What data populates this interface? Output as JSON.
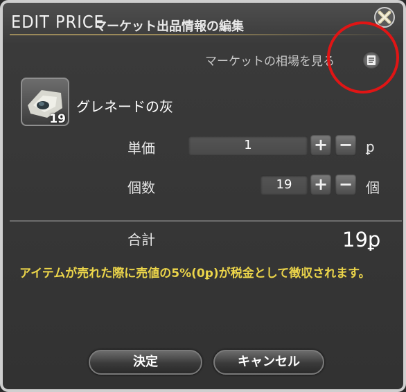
{
  "window": {
    "title_en": "EDIT PRICE",
    "title_jp": "マーケット出品情報の編集",
    "close_icon": "close-x-icon"
  },
  "market": {
    "link_label": "マーケットの相場を見る",
    "icon": "document-icon",
    "annotation_color": "#e01515"
  },
  "item": {
    "name": "グレネードの灰",
    "quantity": "19",
    "icon": "grenade-ash-icon"
  },
  "unit_price": {
    "label": "単価",
    "value": "1",
    "unit": "ꝑ",
    "plus": "+",
    "minus": "−"
  },
  "quantity": {
    "label": "個数",
    "value": "19",
    "unit": "個",
    "plus": "+",
    "minus": "−"
  },
  "total": {
    "label": "合計",
    "value": "19ꝑ"
  },
  "tax_note": {
    "text": "アイテムが売れた際に売値の5%(0ꝑ)が税金として徴収されます。",
    "color": "#ecd54a"
  },
  "buttons": {
    "confirm": "決定",
    "cancel": "キャンセル"
  }
}
